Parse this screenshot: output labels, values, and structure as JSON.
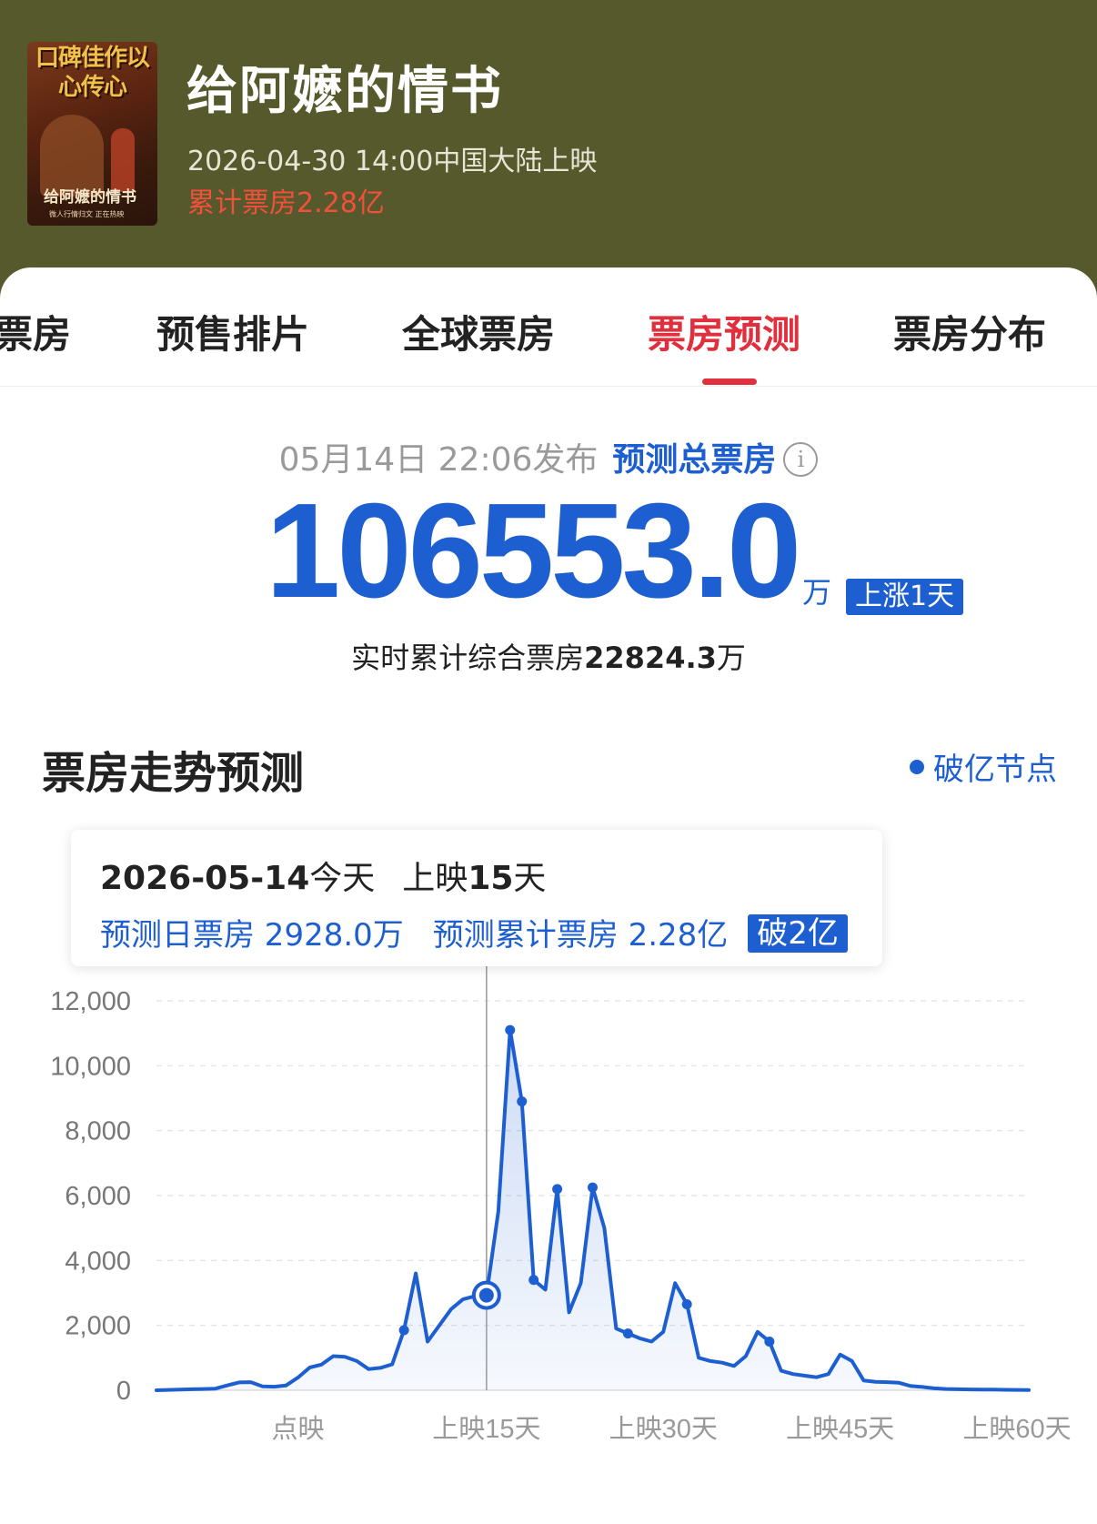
{
  "movie": {
    "poster_slogan": "口碑佳作以心传心",
    "poster_title": "给阿嬷的情书",
    "poster_sub": "微人行情归文 正在热映",
    "title": "给阿嬷的情书",
    "release": "2026-04-30 14:00中国大陆上映",
    "cumulative": "累计票房2.28亿"
  },
  "tabs": [
    {
      "label": "票房"
    },
    {
      "label": "预售排片"
    },
    {
      "label": "全球票房"
    },
    {
      "label": "票房预测"
    },
    {
      "label": "票房分布"
    }
  ],
  "forecast": {
    "publish_date": "05月14日  22:06发布",
    "total_label": "预测总票房",
    "info_icon": "i",
    "value": "106553.0",
    "unit": "万",
    "badge": "上涨1天",
    "realtime_label": "实时累计综合票房",
    "realtime_value": "22824.3",
    "realtime_unit": "万"
  },
  "trend": {
    "title": "票房走势预测",
    "legend": "破亿节点"
  },
  "tooltip": {
    "date": "2026-05-14",
    "today": "今天",
    "day_prefix": "上映",
    "day_num": "15",
    "day_suffix": "天",
    "daily": "预测日票房 2928.0万",
    "cumulative": "预测累计票房 2.28亿",
    "badge": "破2亿"
  },
  "colors": {
    "accent": "#1d5fd0",
    "active_tab": "#e0303e",
    "header_bg": "#56592c",
    "cumulative_text": "#f2503a"
  },
  "chart_data": {
    "type": "area",
    "ylim": [
      0,
      12000
    ],
    "yticks": [
      "0",
      "2,000",
      "4,000",
      "6,000",
      "8,000",
      "10,000",
      "12,000"
    ],
    "xtick_labels": [
      {
        "x": -1,
        "label": "点映"
      },
      {
        "x": 15,
        "label": "上映15天"
      },
      {
        "x": 30,
        "label": "上映30天"
      },
      {
        "x": 45,
        "label": "上映45天"
      },
      {
        "x": 60,
        "label": "上映60天"
      }
    ],
    "today_x": 15,
    "today_value": 2928,
    "grid": true,
    "series": [
      {
        "values": [
          [
            -13,
            0
          ],
          [
            -12,
            10
          ],
          [
            -11,
            20
          ],
          [
            -10,
            30
          ],
          [
            -9,
            40
          ],
          [
            -8,
            50
          ],
          [
            -7,
            150
          ],
          [
            -6,
            240
          ],
          [
            -5,
            250
          ],
          [
            -4,
            120
          ],
          [
            -3,
            110
          ],
          [
            -2,
            150
          ],
          [
            -1,
            390
          ],
          [
            0,
            700
          ],
          [
            1,
            790
          ],
          [
            2,
            1050
          ],
          [
            3,
            1030
          ],
          [
            4,
            900
          ],
          [
            5,
            650
          ],
          [
            6,
            690
          ],
          [
            7,
            800
          ],
          [
            8,
            1850
          ],
          [
            9,
            3600
          ],
          [
            10,
            1500
          ],
          [
            11,
            2000
          ],
          [
            12,
            2500
          ],
          [
            13,
            2800
          ],
          [
            14,
            2900
          ],
          [
            15,
            2928
          ],
          [
            16,
            5500
          ],
          [
            17,
            11100
          ],
          [
            18,
            8900
          ],
          [
            19,
            3400
          ],
          [
            20,
            3100
          ],
          [
            21,
            6200
          ],
          [
            22,
            2400
          ],
          [
            23,
            3300
          ],
          [
            24,
            6250
          ],
          [
            25,
            5000
          ],
          [
            26,
            1900
          ],
          [
            27,
            1750
          ],
          [
            28,
            1600
          ],
          [
            29,
            1500
          ],
          [
            30,
            1800
          ],
          [
            31,
            3300
          ],
          [
            32,
            2650
          ],
          [
            33,
            1000
          ],
          [
            34,
            900
          ],
          [
            35,
            850
          ],
          [
            36,
            750
          ],
          [
            37,
            1050
          ],
          [
            38,
            1800
          ],
          [
            39,
            1500
          ],
          [
            40,
            600
          ],
          [
            41,
            500
          ],
          [
            42,
            450
          ],
          [
            43,
            400
          ],
          [
            44,
            500
          ],
          [
            45,
            1100
          ],
          [
            46,
            900
          ],
          [
            47,
            300
          ],
          [
            48,
            260
          ],
          [
            49,
            250
          ],
          [
            50,
            230
          ],
          [
            51,
            130
          ],
          [
            52,
            100
          ],
          [
            53,
            60
          ],
          [
            54,
            40
          ],
          [
            55,
            30
          ],
          [
            56,
            25
          ],
          [
            57,
            20
          ],
          [
            58,
            20
          ],
          [
            59,
            15
          ],
          [
            60,
            10
          ],
          [
            61,
            5
          ]
        ],
        "markers_x": [
          8,
          17,
          18,
          19,
          21,
          24,
          27,
          32,
          39
        ]
      }
    ]
  }
}
